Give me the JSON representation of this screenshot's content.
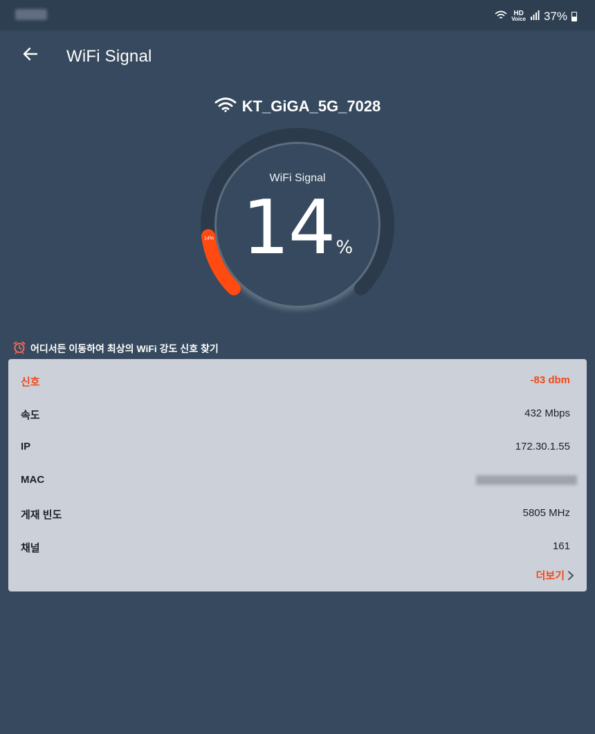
{
  "status_bar": {
    "hd_label": "HD",
    "voice_label": "Voice",
    "battery_percent": "37%"
  },
  "header": {
    "title": "WiFi Signal"
  },
  "network": {
    "ssid": "KT_GiGA_5G_7028"
  },
  "gauge": {
    "label": "WiFi Signal",
    "value": "14",
    "unit": "%",
    "marker_label": "14%",
    "level_percent": 14,
    "accent_color": "#ff4a12",
    "track_color": "#2c3b4c"
  },
  "tip": {
    "text": "어디서든 이동하여 최상의 WiFi 강도 신호 찾기"
  },
  "details": {
    "rows": [
      {
        "label": "신호",
        "value": "-83 dbm"
      },
      {
        "label": "속도",
        "value": "432 Mbps"
      },
      {
        "label": "IP",
        "value": "172.30.1.55"
      },
      {
        "label": "MAC",
        "value": ""
      },
      {
        "label": "게재 빈도",
        "value": "5805 MHz"
      },
      {
        "label": "채널",
        "value": "161"
      }
    ],
    "more_label": "더보기"
  }
}
